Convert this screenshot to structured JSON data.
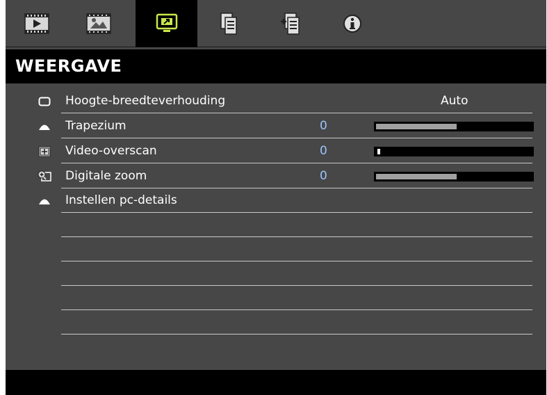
{
  "tabs": [
    {
      "name": "tab-image",
      "icon": "image-settings-icon",
      "active": false
    },
    {
      "name": "tab-picture-adjust",
      "icon": "picture-adjust-icon",
      "active": false
    },
    {
      "name": "tab-display",
      "icon": "display-icon",
      "active": true
    },
    {
      "name": "tab-setup",
      "icon": "setup-document-icon",
      "active": false
    },
    {
      "name": "tab-options",
      "icon": "options-document-icon",
      "active": false
    },
    {
      "name": "tab-info",
      "icon": "info-icon",
      "active": false
    }
  ],
  "header": {
    "title": "WEERGAVE"
  },
  "menu": {
    "items": [
      {
        "label": "Hoogte-breedteverhouding",
        "value": "Auto",
        "icon": "aspect-ratio-icon"
      },
      {
        "label": "Trapezium",
        "value": "0",
        "icon": "triangle-icon",
        "level": 0.5
      },
      {
        "label": "Video-overscan",
        "value": "0",
        "icon": "overscan-icon",
        "level": 0.02
      },
      {
        "label": "Digitale zoom",
        "value": "0",
        "icon": "zoom-icon",
        "level": 0.5
      },
      {
        "label": "Instellen pc-details",
        "icon": "triangle-icon"
      }
    ]
  },
  "colors": {
    "background": "#474747",
    "header": "#000000",
    "value_blue": "#9ac4ff",
    "active_icon": "#c8e84a"
  }
}
